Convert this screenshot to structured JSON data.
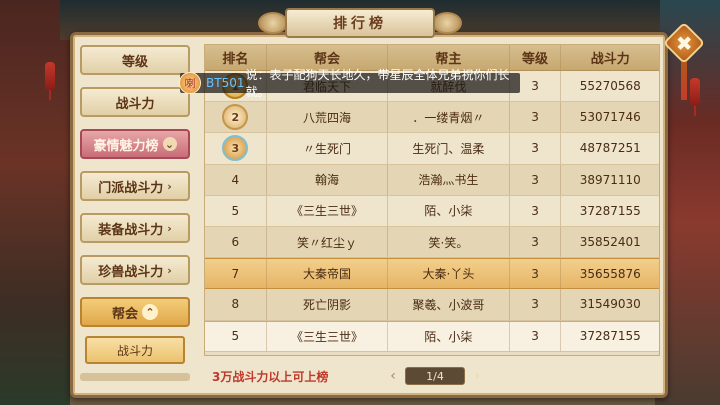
{
  "title": "排行榜",
  "close_glyph": "✖",
  "menu": [
    {
      "label": "等级",
      "chev": ""
    },
    {
      "label": "战斗力",
      "chev": ""
    },
    {
      "label": "豪情魅力榜",
      "chev": "⌄"
    },
    {
      "label": "门派战斗力",
      "chev": "›"
    },
    {
      "label": "装备战斗力",
      "chev": "›"
    },
    {
      "label": "珍兽战斗力",
      "chev": "›"
    },
    {
      "label": "帮会",
      "chev": "⌃"
    }
  ],
  "submenu": {
    "label": "战斗力"
  },
  "table": {
    "headers": [
      "排名",
      "帮会",
      "帮主",
      "等级",
      "战斗力"
    ],
    "rows": [
      {
        "rank": "1",
        "guild": "君临天下",
        "leader": "就醉伐",
        "level": "3",
        "power": "55270568"
      },
      {
        "rank": "2",
        "guild": "八荒四海",
        "leader": "．一缕青烟〃",
        "level": "3",
        "power": "53071746"
      },
      {
        "rank": "3",
        "guild": "〃生死门",
        "leader": "生死门、温柔",
        "level": "3",
        "power": "48787251"
      },
      {
        "rank": "4",
        "guild": "翰海",
        "leader": "浩瀚灬书生",
        "level": "3",
        "power": "38971110"
      },
      {
        "rank": "5",
        "guild": "《三生三世》",
        "leader": "陌、小柒",
        "level": "3",
        "power": "37287155"
      },
      {
        "rank": "6",
        "guild": "笑〃红尘ｙ",
        "leader": "笑·笑。",
        "level": "3",
        "power": "35852401"
      },
      {
        "rank": "7",
        "guild": "大秦帝国",
        "leader": "大秦·丫头",
        "level": "3",
        "power": "35655876"
      },
      {
        "rank": "8",
        "guild": "死亡阴影",
        "leader": "聚羲、小波哥",
        "level": "3",
        "power": "31549030"
      }
    ],
    "self_row": {
      "rank": "5",
      "guild": "《三生三世》",
      "leader": "陌、小柒",
      "level": "3",
      "power": "37287155"
    }
  },
  "chat": {
    "icon": "喇",
    "name": "BT501",
    "text": "说：表子配狗天长地久，带星辰全体兄弟祝你们长就。"
  },
  "footer_note": "3万战斗力以上可上榜",
  "pager": {
    "prev": "‹",
    "current": "1/4",
    "next": "›"
  }
}
